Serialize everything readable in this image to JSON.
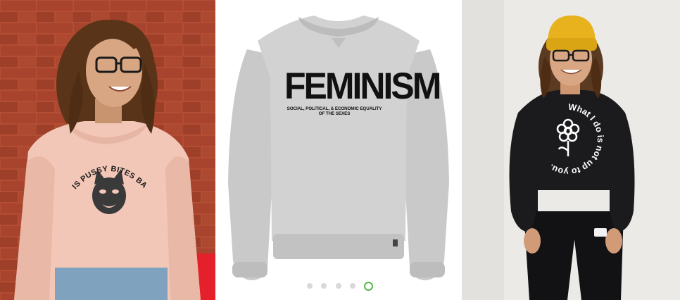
{
  "left_photo": {
    "hoodie_print": "THIS PUSSY BITES BACK"
  },
  "middle_product": {
    "title": "FEMINISM",
    "subtitle": "SOCIAL, POLITICAL, & ECONOMIC EQUALITY OF THE SEXES"
  },
  "right_photo": {
    "hoodie_print": "What I do is not up to you."
  },
  "carousel": {
    "dot_count": 5,
    "active_index": 4,
    "active_color": "#58b84a",
    "inactive_color": "#d9d9d9"
  },
  "colors": {
    "brick": "#a5432b",
    "pink_hoodie": "#f2c7b8",
    "grey_sweatshirt": "#cfcfcf",
    "black_hoodie": "#1b1b1d",
    "beanie": "#e7b21d"
  }
}
